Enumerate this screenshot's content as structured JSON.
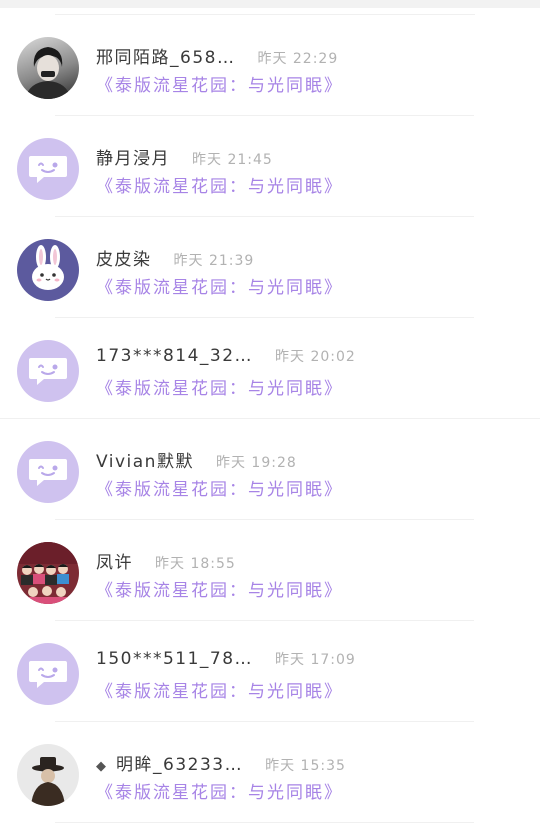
{
  "comments": [
    {
      "name": "邢同陌路_658…",
      "time": "昨天 22:29",
      "book": "《泰版流星花园：与光同眠》",
      "avatar": "avatar-dark-portrait",
      "diamond": ""
    },
    {
      "name": "静月浸月",
      "time": "昨天 21:45",
      "book": "《泰版流星花园：与光同眠》",
      "avatar": "avatar-default-chat",
      "diamond": ""
    },
    {
      "name": "皮皮染",
      "time": "昨天 21:39",
      "book": "《泰版流星花园：与光同眠》",
      "avatar": "avatar-bunny",
      "diamond": ""
    },
    {
      "name": "173***814_32…",
      "time": "昨天 20:02",
      "book": "《泰版流星花园：与光同眠》",
      "avatar": "avatar-default-chat",
      "diamond": ""
    },
    {
      "name": "Vivian默默",
      "time": "昨天 19:28",
      "book": "《泰版流星花园：与光同眠》",
      "avatar": "avatar-default-chat",
      "diamond": ""
    },
    {
      "name": "凤许",
      "time": "昨天 18:55",
      "book": "《泰版流星花园：与光同眠》",
      "avatar": "avatar-group-photo",
      "diamond": ""
    },
    {
      "name": "150***511_78…",
      "time": "昨天 17:09",
      "book": "《泰版流星花园：与光同眠》",
      "avatar": "avatar-default-chat",
      "diamond": ""
    },
    {
      "name": "明眸_63233…",
      "time": "昨天 15:35",
      "book": "《泰版流星花园：与光同眠》",
      "avatar": "avatar-hat-figure",
      "diamond": "◆"
    }
  ],
  "colors": {
    "accent": "#a784e6",
    "avatar_default": "#cfc2ef",
    "name": "#3a3a3a",
    "time": "#b2b2b2"
  }
}
